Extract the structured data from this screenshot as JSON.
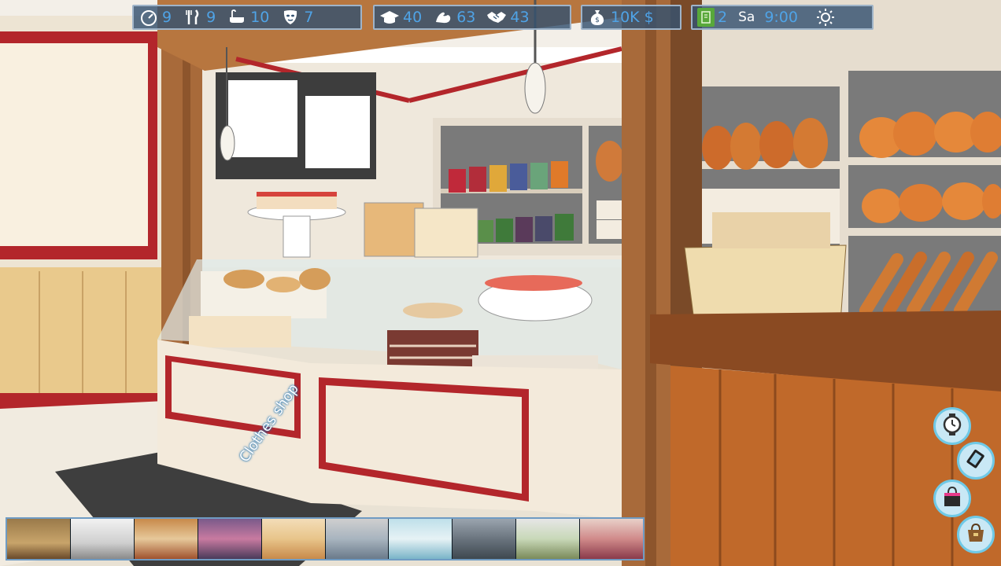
{
  "hud": {
    "needs": {
      "energy": "9",
      "hunger": "9",
      "hygiene": "10",
      "mood": "7"
    },
    "skills": {
      "education": "40",
      "fitness": "63",
      "social": "43"
    },
    "money": "10K $",
    "time": {
      "cards": "2",
      "day": "Sa",
      "clock": "9:00"
    }
  },
  "location_label": "Clothes shop",
  "thumbnails": [
    "mall-hall",
    "bakery",
    "grocery",
    "clothes-shop",
    "shop-interior",
    "kitchen-store",
    "electronics",
    "office",
    "cafe",
    "gift-shop"
  ],
  "side_buttons": [
    "wait-watch",
    "phone",
    "shopping-bag",
    "inventory-bag"
  ]
}
